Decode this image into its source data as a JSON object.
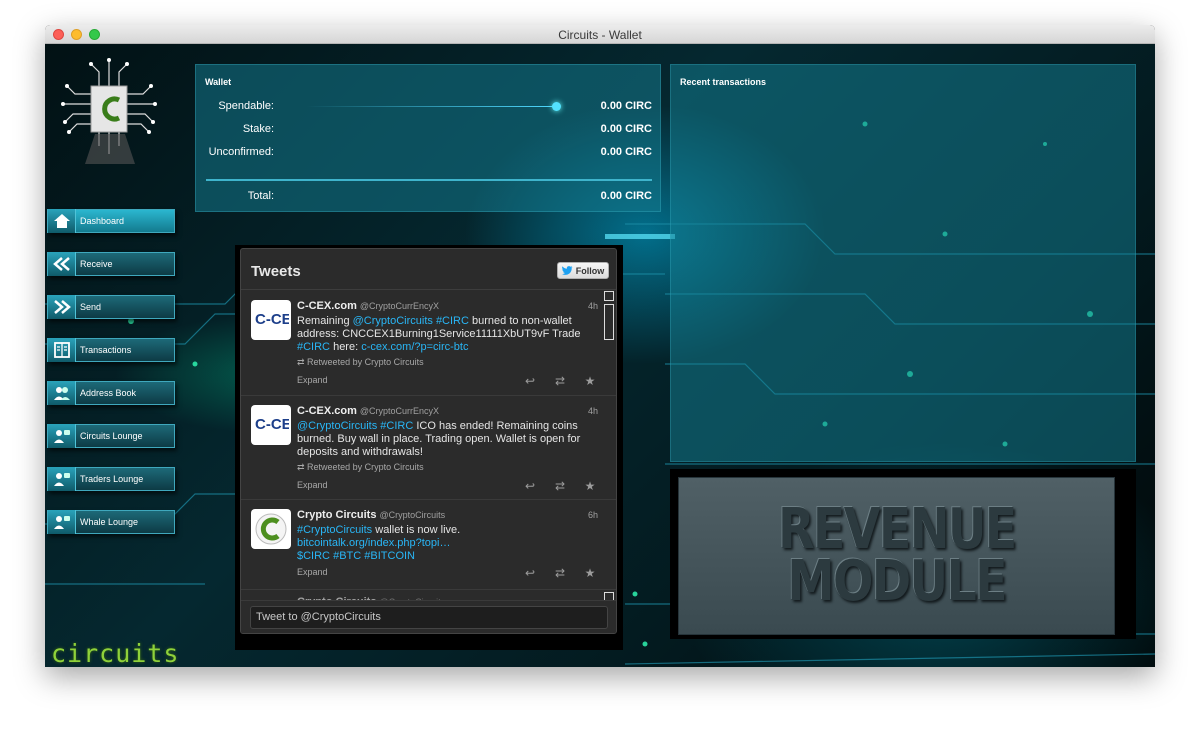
{
  "window": {
    "title": "Circuits - Wallet"
  },
  "sidebar": {
    "items": [
      {
        "label": "Dashboard",
        "icon": "home-icon",
        "active": true
      },
      {
        "label": "Receive",
        "icon": "receive-arrows-icon"
      },
      {
        "label": "Send",
        "icon": "send-arrows-icon"
      },
      {
        "label": "Transactions",
        "icon": "ledger-icon"
      },
      {
        "label": "Address Book",
        "icon": "contacts-icon"
      },
      {
        "label": "Circuits Lounge",
        "icon": "user-chat-icon"
      },
      {
        "label": "Traders Lounge",
        "icon": "user-chat-icon"
      },
      {
        "label": "Whale Lounge",
        "icon": "user-chat-icon"
      }
    ],
    "brand": "circuits",
    "status_icons": [
      "lock-icon",
      "lightning-icon",
      "signal-icon",
      "check-icon"
    ]
  },
  "wallet": {
    "heading": "Wallet",
    "spendable_label": "Spendable:",
    "spendable_value": "0.00 CIRC",
    "stake_label": "Stake:",
    "stake_value": "0.00 CIRC",
    "unconfirmed_label": "Unconfirmed:",
    "unconfirmed_value": "0.00 CIRC",
    "total_label": "Total:",
    "total_value": "0.00 CIRC"
  },
  "recent_transactions": {
    "heading": "Recent transactions"
  },
  "revenue_module": {
    "line1": "REVENUE",
    "line2": "MODULE"
  },
  "tweets": {
    "title": "Tweets",
    "follow_label": "Follow",
    "input_placeholder": "Tweet to @CryptoCircuits",
    "items": [
      {
        "name": "C-CEX.com",
        "handle": "@CryptoCurrEncyX",
        "time": "4h",
        "avatar": "C-CEX",
        "text_parts": [
          "Remaining ",
          "@CryptoCircuits",
          " ",
          "#CIRC",
          " burned to non-wallet address: CNCCEX1Burning1Service11111XbUT9vF Trade ",
          "#CIRC",
          " here: ",
          "c-cex.com/?p=circ-btc"
        ],
        "retweeted_by": "Retweeted by Crypto Circuits",
        "expand": "Expand"
      },
      {
        "name": "C-CEX.com",
        "handle": "@CryptoCurrEncyX",
        "time": "4h",
        "avatar": "C-CEX",
        "text_parts": [
          "@CryptoCircuits",
          " ",
          "#CIRC",
          " ICO has ended! Remaining coins burned. Buy wall in place. Trading open. Wallet is open for deposits and withdrawals!"
        ],
        "retweeted_by": "Retweeted by Crypto Circuits",
        "expand": "Expand"
      },
      {
        "name": "Crypto Circuits",
        "handle": "@CryptoCircuits",
        "time": "6h",
        "avatar": "C",
        "text_parts": [
          "#CryptoCircuits",
          " wallet is now live. ",
          "bitcointalk.org/index.php?topi…",
          " ",
          "$CIRC",
          " ",
          "#BTC",
          " ",
          "#BITCOIN"
        ],
        "expand": "Expand"
      },
      {
        "name": "Crypto Circuits",
        "handle": "@CryptoCircuits"
      }
    ]
  },
  "colors": {
    "accent": "#29b6f6",
    "panel": "#147c8c",
    "brand_green": "#8fd13a"
  }
}
